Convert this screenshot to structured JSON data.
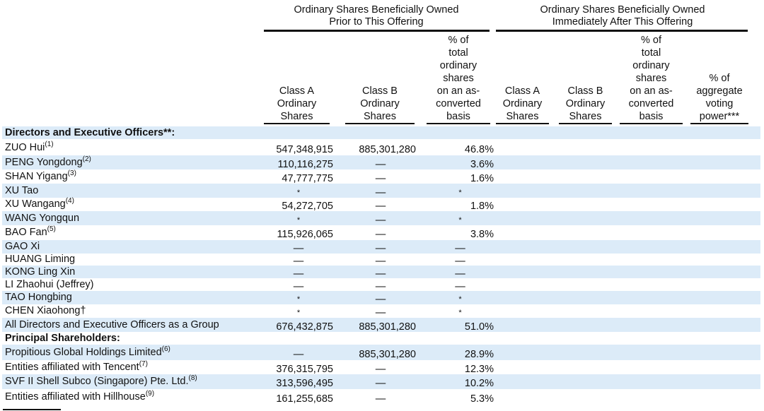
{
  "groups": [
    {
      "line1": "Ordinary Shares Beneficially Owned",
      "line2": "Prior to This Offering"
    },
    {
      "line1": "Ordinary Shares Beneficially Owned",
      "line2": "Immediately After This Offering"
    }
  ],
  "columns": [
    [
      "Class A",
      "Ordinary",
      "Shares"
    ],
    [
      "Class B",
      "Ordinary",
      "Shares"
    ],
    [
      "% of",
      "total",
      "ordinary",
      "shares",
      "on an as-",
      "converted",
      "basis"
    ],
    [
      "Class A",
      "Ordinary",
      "Shares"
    ],
    [
      "Class B",
      "Ordinary",
      "Shares"
    ],
    [
      "% of",
      "total",
      "ordinary",
      "shares",
      "on an as-",
      "converted",
      "basis"
    ],
    [
      "% of",
      "aggregate",
      "voting",
      "power***"
    ]
  ],
  "rows": [
    {
      "name": "Directors and Executive Officers**:",
      "sup": "",
      "bold": true,
      "a": "",
      "b": "",
      "pct": ""
    },
    {
      "name": "ZUO Hui",
      "sup": "(1)",
      "bold": false,
      "a": "547,348,915",
      "b": "885,301,280",
      "pct": "46.8%"
    },
    {
      "name": "PENG Yongdong",
      "sup": "(2)",
      "bold": false,
      "a": "110,116,275",
      "b": "—",
      "pct": "3.6%"
    },
    {
      "name": "SHAN Yigang",
      "sup": "(3)",
      "bold": false,
      "a": "47,777,775",
      "b": "—",
      "pct": "1.6%"
    },
    {
      "name": "XU Tao",
      "sup": "",
      "bold": false,
      "a": "*",
      "b": "—",
      "pct": "*"
    },
    {
      "name": "XU Wangang",
      "sup": "(4)",
      "bold": false,
      "a": "54,272,705",
      "b": "—",
      "pct": "1.8%"
    },
    {
      "name": "WANG Yongqun",
      "sup": "",
      "bold": false,
      "a": "*",
      "b": "—",
      "pct": "*"
    },
    {
      "name": "BAO Fan",
      "sup": "(5)",
      "bold": false,
      "a": "115,926,065",
      "b": "—",
      "pct": "3.8%"
    },
    {
      "name": "GAO Xi",
      "sup": "",
      "bold": false,
      "a": "—",
      "b": "—",
      "pct": "—"
    },
    {
      "name": "HUANG Liming",
      "sup": "",
      "bold": false,
      "a": "—",
      "b": "—",
      "pct": "—"
    },
    {
      "name": "KONG Ling Xin",
      "sup": "",
      "bold": false,
      "a": "—",
      "b": "—",
      "pct": "—"
    },
    {
      "name": "LI Zhaohui (Jeffrey)",
      "sup": "",
      "bold": false,
      "a": "—",
      "b": "—",
      "pct": "—"
    },
    {
      "name": "TAO Hongbing",
      "sup": "",
      "bold": false,
      "a": "*",
      "b": "—",
      "pct": "*"
    },
    {
      "name": "CHEN Xiaohong†",
      "sup": "",
      "bold": false,
      "a": "*",
      "b": "—",
      "pct": "*"
    },
    {
      "name": "All Directors and Executive Officers as a Group",
      "sup": "",
      "bold": false,
      "a": "676,432,875",
      "b": "885,301,280",
      "pct": "51.0%"
    },
    {
      "name": "Principal Shareholders:",
      "sup": "",
      "bold": true,
      "a": "",
      "b": "",
      "pct": ""
    },
    {
      "name": "Propitious Global Holdings Limited",
      "sup": "(6)",
      "bold": false,
      "a": "—",
      "b": "885,301,280",
      "pct": "28.9%"
    },
    {
      "name": "Entities affiliated with Tencent",
      "sup": "(7)",
      "bold": false,
      "a": "376,315,795",
      "b": "—",
      "pct": "12.3%"
    },
    {
      "name": "SVF II Shell Subco (Singapore) Pte. Ltd.",
      "sup": "(8)",
      "bold": false,
      "a": "313,596,495",
      "b": "—",
      "pct": "10.2%"
    },
    {
      "name": "Entities affiliated with Hillhouse",
      "sup": "(9)",
      "bold": false,
      "a": "161,255,685",
      "b": "—",
      "pct": "5.3%"
    }
  ]
}
